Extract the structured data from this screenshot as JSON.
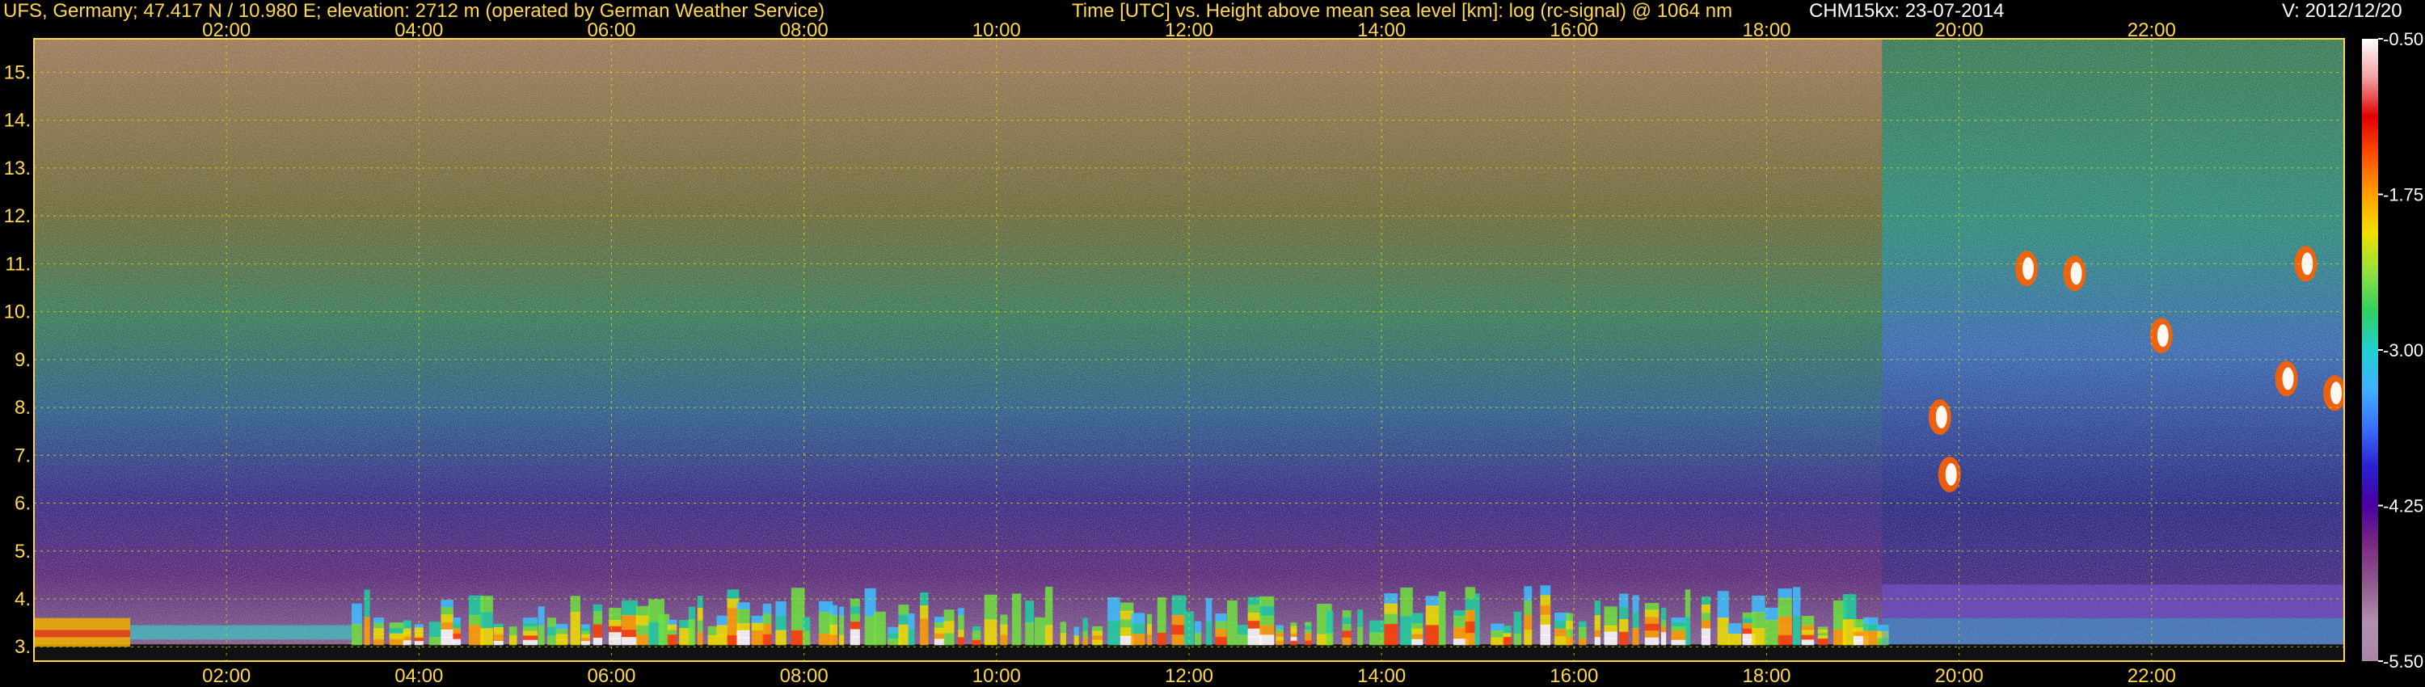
{
  "header": {
    "station": "UFS, Germany; 47.417 N / 10.980 E; elevation: 2712 m  (operated by German Weather Service)",
    "description": "Time [UTC] vs. Height above mean sea level [km]: log (rc-signal) @ 1064 nm",
    "instrument_date": "CHM15kx: 23-07-2014",
    "version": "V: 2012/12/20"
  },
  "colors": {
    "background": "#000000",
    "header_text": "#ffd84a",
    "grid": "#e6e600",
    "frame": "#ffd84a"
  },
  "chart_data": {
    "type": "heatmap",
    "title": "Time [UTC] vs. Height above mean sea level [km]: log (rc-signal) @ 1064 nm",
    "xlabel": "Time [UTC]",
    "ylabel": "Height above mean sea level [km]",
    "x_ticks": [
      "02:00",
      "04:00",
      "06:00",
      "08:00",
      "10:00",
      "12:00",
      "14:00",
      "16:00",
      "18:00",
      "20:00",
      "22:00"
    ],
    "x_tick_hours": [
      2,
      4,
      6,
      8,
      10,
      12,
      14,
      16,
      18,
      20,
      22
    ],
    "xlim_hours": [
      0,
      24
    ],
    "y_ticks": [
      "3.",
      "4.",
      "5.",
      "6.",
      "7.",
      "8.",
      "9.",
      "10.",
      "11.",
      "12.",
      "13.",
      "14.",
      "15."
    ],
    "y_tick_values": [
      3,
      4,
      5,
      6,
      7,
      8,
      9,
      10,
      11,
      12,
      13,
      14,
      15
    ],
    "ylim_km": [
      2.7,
      15.7
    ],
    "grid": true,
    "colorbar": {
      "ticks": [
        "-0.50",
        "-1.75",
        "-3.00",
        "-4.25",
        "-5.50"
      ],
      "tick_values": [
        -0.5,
        -1.75,
        -3.0,
        -4.25,
        -5.5
      ],
      "range": [
        -5.5,
        -0.5
      ],
      "colors": [
        "#a986a8",
        "#b291b0",
        "#8e5a8e",
        "#7a2a80",
        "#4a00a0",
        "#2a20d0",
        "#3a70ff",
        "#40b0ff",
        "#20d0d0",
        "#30d060",
        "#90e040",
        "#f0e000",
        "#ffa000",
        "#ff5000",
        "#e00000",
        "#f0a0a0",
        "#ffffff"
      ]
    },
    "features": {
      "boundary_layer_clouds_hours": [
        3.3,
        19.2
      ],
      "boundary_layer_top_km": 4.0,
      "cirrus_patches": [
        {
          "hour": 20.7,
          "km": 10.9
        },
        {
          "hour": 21.2,
          "km": 10.8
        },
        {
          "hour": 23.6,
          "km": 11.0
        },
        {
          "hour": 22.1,
          "km": 9.5
        },
        {
          "hour": 19.8,
          "km": 7.8
        },
        {
          "hour": 19.9,
          "km": 6.6
        },
        {
          "hour": 23.4,
          "km": 8.6
        },
        {
          "hour": 23.9,
          "km": 8.3
        }
      ]
    }
  }
}
